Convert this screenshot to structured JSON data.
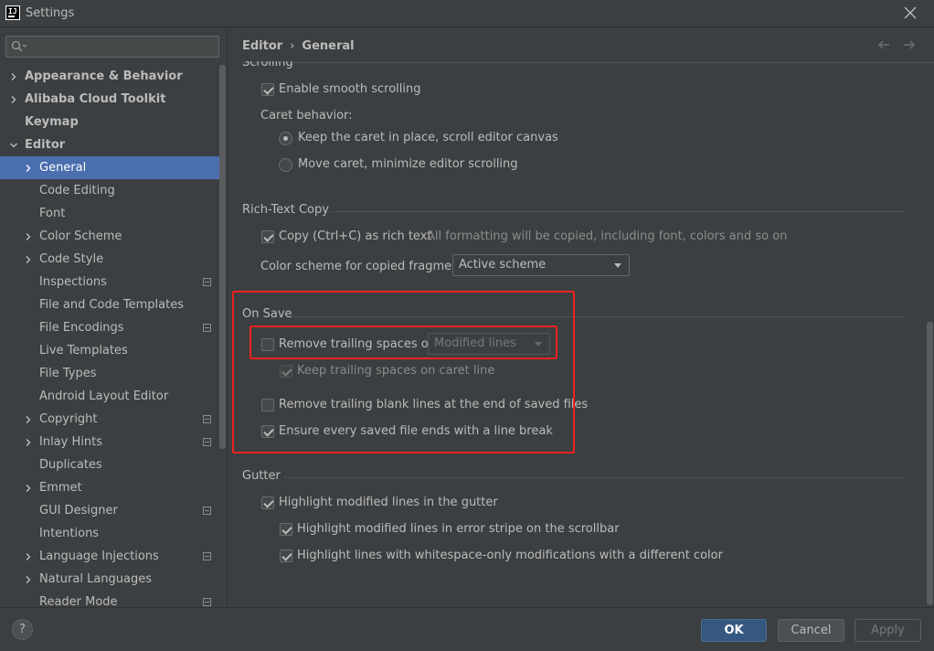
{
  "window": {
    "title": "Settings",
    "logo_text": "IJ"
  },
  "breadcrumb": {
    "parent": "Editor",
    "separator": "›",
    "current": "General"
  },
  "search": {
    "placeholder": ""
  },
  "sidebar": {
    "items": [
      {
        "label": "Appearance & Behavior",
        "level": 0,
        "expand": "collapsed",
        "bold": true
      },
      {
        "label": "Alibaba Cloud Toolkit",
        "level": 0,
        "expand": "collapsed",
        "bold": true
      },
      {
        "label": "Keymap",
        "level": 0,
        "expand": "none",
        "bold": true
      },
      {
        "label": "Editor",
        "level": 0,
        "expand": "expanded",
        "bold": true
      },
      {
        "label": "General",
        "level": 1,
        "expand": "collapsed",
        "selected": true
      },
      {
        "label": "Code Editing",
        "level": 1,
        "expand": "none"
      },
      {
        "label": "Font",
        "level": 1,
        "expand": "none"
      },
      {
        "label": "Color Scheme",
        "level": 1,
        "expand": "collapsed"
      },
      {
        "label": "Code Style",
        "level": 1,
        "expand": "collapsed"
      },
      {
        "label": "Inspections",
        "level": 1,
        "expand": "none",
        "project": true
      },
      {
        "label": "File and Code Templates",
        "level": 1,
        "expand": "none"
      },
      {
        "label": "File Encodings",
        "level": 1,
        "expand": "none",
        "project": true
      },
      {
        "label": "Live Templates",
        "level": 1,
        "expand": "none"
      },
      {
        "label": "File Types",
        "level": 1,
        "expand": "none"
      },
      {
        "label": "Android Layout Editor",
        "level": 1,
        "expand": "none"
      },
      {
        "label": "Copyright",
        "level": 1,
        "expand": "collapsed",
        "project": true
      },
      {
        "label": "Inlay Hints",
        "level": 1,
        "expand": "collapsed",
        "project": true
      },
      {
        "label": "Duplicates",
        "level": 1,
        "expand": "none"
      },
      {
        "label": "Emmet",
        "level": 1,
        "expand": "collapsed"
      },
      {
        "label": "GUI Designer",
        "level": 1,
        "expand": "none",
        "project": true
      },
      {
        "label": "Intentions",
        "level": 1,
        "expand": "none"
      },
      {
        "label": "Language Injections",
        "level": 1,
        "expand": "collapsed",
        "project": true
      },
      {
        "label": "Natural Languages",
        "level": 1,
        "expand": "collapsed"
      },
      {
        "label": "Reader Mode",
        "level": 1,
        "expand": "none",
        "project": true
      }
    ]
  },
  "scrolling": {
    "title": "Scrolling",
    "smooth_scrolling": {
      "label": "Enable smooth scrolling",
      "checked": true
    },
    "caret_behavior_label": "Caret behavior:",
    "caret_options": [
      {
        "label": "Keep the caret in place, scroll editor canvas",
        "selected": true
      },
      {
        "label": "Move caret, minimize editor scrolling",
        "selected": false
      }
    ]
  },
  "rich_text": {
    "title": "Rich-Text Copy",
    "copy_rich": {
      "label": "Copy (Ctrl+C) as rich text",
      "checked": true
    },
    "hint": "All formatting will be copied, including font, colors and so on",
    "scheme_label": "Color scheme for copied fragment:",
    "scheme_value": "Active scheme"
  },
  "on_save": {
    "title": "On Save",
    "remove_trailing": {
      "label": "Remove trailing spaces on:",
      "checked": false
    },
    "trailing_mode": "Modified lines",
    "keep_trailing": {
      "label": "Keep trailing spaces on caret line",
      "checked": true,
      "disabled": true
    },
    "remove_blank": {
      "label": "Remove trailing blank lines at the end of saved files",
      "checked": false
    },
    "ensure_break": {
      "label": "Ensure every saved file ends with a line break",
      "checked": true
    }
  },
  "gutter": {
    "title": "Gutter",
    "highlight_gutter": {
      "label": "Highlight modified lines in the gutter",
      "checked": true
    },
    "highlight_stripe": {
      "label": "Highlight modified lines in error stripe on the scrollbar",
      "checked": true
    },
    "highlight_whitespace": {
      "label": "Highlight lines with whitespace-only modifications with a different color",
      "checked": true
    }
  },
  "buttons": {
    "help": "?",
    "ok": "OK",
    "cancel": "Cancel",
    "apply": "Apply"
  },
  "colors": {
    "background": "#3c3f41",
    "selection": "#4b6eaf",
    "primary_button": "#365880",
    "highlight_box": "#e8231f"
  }
}
